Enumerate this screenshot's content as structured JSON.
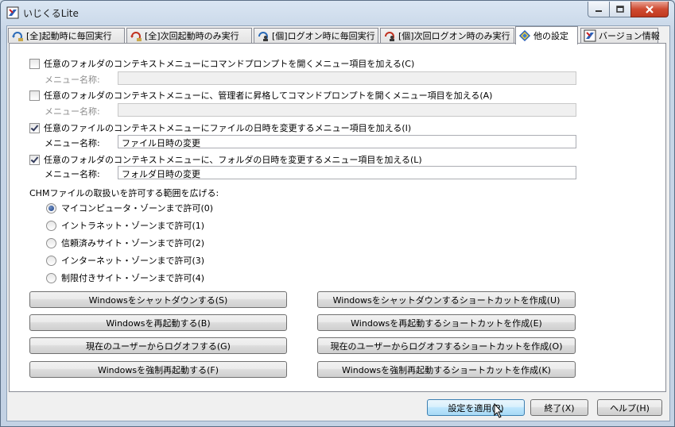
{
  "window": {
    "title": "いじくるLite"
  },
  "tabs": [
    {
      "label": "[全]起動時に毎回実行"
    },
    {
      "label": "[全]次回起動時のみ実行"
    },
    {
      "label": "[個]ログオン時に毎回実行"
    },
    {
      "label": "[個]次回ログオン時のみ実行"
    },
    {
      "label": "他の設定"
    },
    {
      "label": "バージョン情報"
    }
  ],
  "options": [
    {
      "label": "任意のフォルダのコンテキストメニューにコマンドプロンプトを開くメニュー項目を加える(C)",
      "checked": false,
      "name_label": "メニュー名称:",
      "name_value": ""
    },
    {
      "label": "任意のフォルダのコンテキストメニューに、管理者に昇格してコマンドプロンプトを開くメニュー項目を加える(A)",
      "checked": false,
      "name_label": "メニュー名称:",
      "name_value": ""
    },
    {
      "label": "任意のファイルのコンテキストメニューにファイルの日時を変更するメニュー項目を加える(I)",
      "checked": true,
      "name_label": "メニュー名称:",
      "name_value": "ファイル日時の変更"
    },
    {
      "label": "任意のフォルダのコンテキストメニューに、フォルダの日時を変更するメニュー項目を加える(L)",
      "checked": true,
      "name_label": "メニュー名称:",
      "name_value": "フォルダ日時の変更"
    }
  ],
  "chm": {
    "heading": "CHMファイルの取扱いを許可する範囲を広げる:",
    "radios": [
      {
        "label": "マイコンピュータ・ゾーンまで許可(0)",
        "checked": true
      },
      {
        "label": "イントラネット・ゾーンまで許可(1)",
        "checked": false
      },
      {
        "label": "信頼済みサイト・ゾーンまで許可(2)",
        "checked": false
      },
      {
        "label": "インターネット・ゾーンまで許可(3)",
        "checked": false
      },
      {
        "label": "制限付きサイト・ゾーンまで許可(4)",
        "checked": false
      }
    ]
  },
  "actions": {
    "shutdown": "Windowsをシャットダウンする(S)",
    "shutdown_shortcut": "Windowsをシャットダウンするショートカットを作成(U)",
    "reboot": "Windowsを再起動する(B)",
    "reboot_shortcut": "Windowsを再起動するショートカットを作成(E)",
    "logoff": "現在のユーザーからログオフする(G)",
    "logoff_shortcut": "現在のユーザーからログオフするショートカットを作成(O)",
    "force_reboot": "Windowsを強制再起動する(F)",
    "force_reboot_shortcut": "Windowsを強制再起動するショートカットを作成(K)"
  },
  "footer": {
    "apply": "設定を適用(P)",
    "exit": "終了(X)",
    "help": "ヘルプ(H)"
  }
}
